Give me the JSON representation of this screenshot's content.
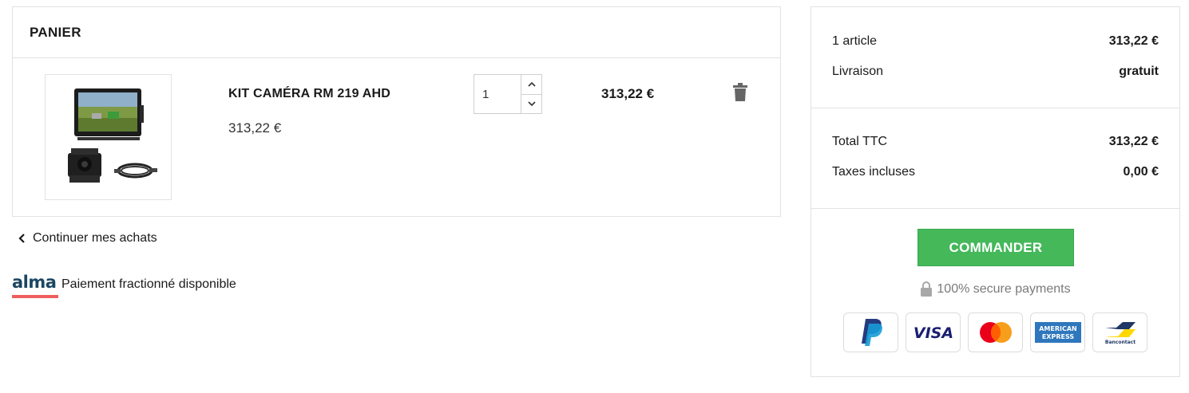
{
  "cart": {
    "title": "PANIER",
    "item": {
      "name": "KIT CAMÉRA RM 219 AHD",
      "unit_price": "313,22 €",
      "quantity": "1",
      "line_total": "313,22 €"
    },
    "continue_label": "Continuer mes achats"
  },
  "alma": {
    "logo": "alma",
    "text": "Paiement fractionné disponible"
  },
  "summary": {
    "rows_top": [
      {
        "label": "1 article",
        "value": "313,22 €"
      },
      {
        "label": "Livraison",
        "value": "gratuit"
      }
    ],
    "rows_totals": [
      {
        "label": "Total TTC",
        "value": "313,22 €"
      },
      {
        "label": "Taxes incluses",
        "value": "0,00 €"
      }
    ],
    "checkout_label": "COMMANDER",
    "secure_label": "100% secure payments",
    "payment_methods": [
      {
        "name": "PayPal",
        "icon": "paypal-icon"
      },
      {
        "name": "VISA",
        "icon": "visa-icon"
      },
      {
        "name": "Mastercard",
        "icon": "mastercard-icon"
      },
      {
        "name": "American Express",
        "icon": "amex-icon"
      },
      {
        "name": "Bancontact",
        "icon": "bancontact-icon"
      }
    ]
  },
  "colors": {
    "accent_green": "#45b85a",
    "alma_blue": "#1b4663",
    "alma_red": "#f05d5e",
    "border": "#e2e2e2"
  }
}
